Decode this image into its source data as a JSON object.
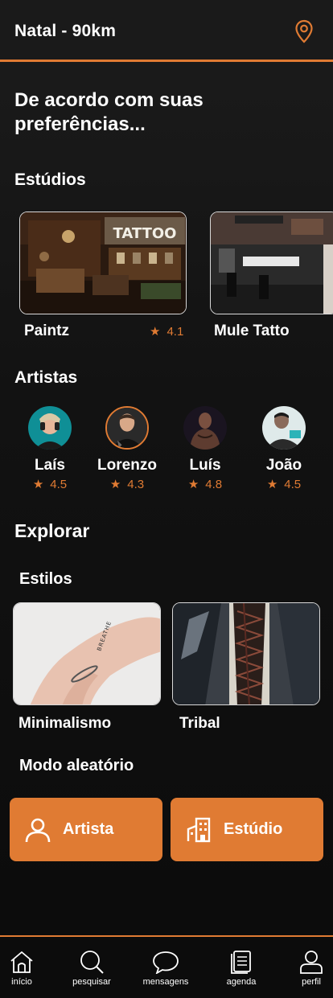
{
  "header": {
    "location": "Natal - 90km",
    "icon": "location-pin-icon"
  },
  "headline": "De acordo com suas preferências...",
  "studios": {
    "title": "Estúdios",
    "items": [
      {
        "name": "Paintz",
        "rating": "4.1"
      },
      {
        "name": "Mule Tatto"
      }
    ],
    "sign_text": "TATTOO"
  },
  "artists": {
    "title": "Artistas",
    "items": [
      {
        "name": "Laís",
        "rating": "4.5"
      },
      {
        "name": "Lorenzo",
        "rating": "4.3"
      },
      {
        "name": "Luís",
        "rating": "4.8"
      },
      {
        "name": "João",
        "rating": "4.5"
      }
    ]
  },
  "explore": {
    "title": "Explorar",
    "styles_title": "Estilos",
    "styles": [
      {
        "name": "Minimalismo",
        "tattoo_text": "BREATHE"
      },
      {
        "name": "Tribal"
      }
    ]
  },
  "random": {
    "title": "Modo aleatório",
    "buttons": [
      {
        "label": "Artista",
        "icon": "user-icon"
      },
      {
        "label": "Estúdio",
        "icon": "building-icon"
      }
    ]
  },
  "nav": [
    {
      "label": "início",
      "icon": "home-icon"
    },
    {
      "label": "pesquisar",
      "icon": "search-icon"
    },
    {
      "label": "mensagens",
      "icon": "chat-icon"
    },
    {
      "label": "agenda",
      "icon": "calendar-icon"
    },
    {
      "label": "perfil",
      "icon": "profile-icon"
    }
  ],
  "colors": {
    "accent": "#e07b33",
    "background": "#121212",
    "text": "#ffffff"
  }
}
